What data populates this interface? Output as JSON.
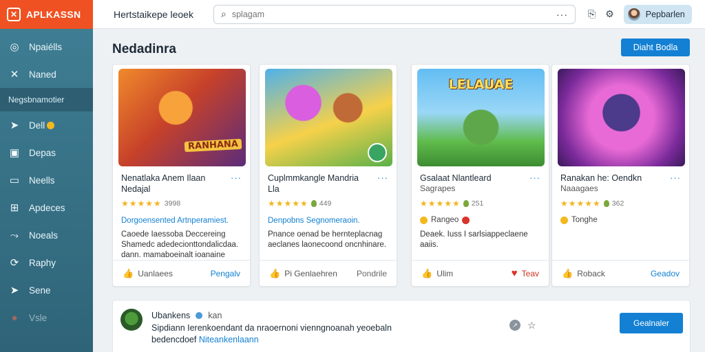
{
  "app": {
    "brand": "APLKASSN",
    "logo_icon": "x-logo-icon"
  },
  "sidebar": {
    "items": [
      {
        "label": "Npaiélls",
        "icon": "compass-icon",
        "glyph": "◎"
      },
      {
        "label": "Naned",
        "icon": "close-icon",
        "glyph": "✕"
      },
      {
        "label": "Negsbnamotier",
        "section": true
      },
      {
        "label": "Dell",
        "icon": "send-icon",
        "glyph": "➤",
        "coin": true
      },
      {
        "label": "Depas",
        "icon": "image-icon",
        "glyph": "▣"
      },
      {
        "label": "Neells",
        "icon": "window-icon",
        "glyph": "▭"
      },
      {
        "label": "Apdeces",
        "icon": "grid-icon",
        "glyph": "⊞"
      },
      {
        "label": "Noeals",
        "icon": "link-icon",
        "glyph": "⤳"
      },
      {
        "label": "Raphy",
        "icon": "refresh-icon",
        "glyph": "⟳"
      },
      {
        "label": "Sene",
        "icon": "send-icon",
        "glyph": "➤"
      },
      {
        "label": "Vsle",
        "icon": "record-icon",
        "glyph": "●",
        "faded": true
      }
    ]
  },
  "topbar": {
    "title": "Hertstaikepe leoek",
    "search_placeholder": "splagam",
    "search_more": "···",
    "icons": [
      "bookmark-icon",
      "gear-icon"
    ],
    "profile_name": "Pepbarlen"
  },
  "main": {
    "title": "Nedadinra",
    "primary_button": "Diaht Bodla"
  },
  "cards": [
    {
      "title": "Nenatlaka Anem Ilaan Nedajal",
      "more": "···",
      "rating": "★★★★★",
      "count": "3998",
      "tagline": "Dorgoensented Artnperamiest.",
      "desc": "Caoede Iaessoba Deccereing Shamedc adedecionttondalicdaa. dann. mamaboeinalt ioanaine",
      "footer_left": "Uanlaees",
      "footer_right": "Pengalv",
      "banner": "RANHANA"
    },
    {
      "title": "Cuplmmkangle Mandria Lla",
      "more": "···",
      "rating": "★★★★★",
      "count": "449",
      "tagline": "Denpobns Segnomeraoin.",
      "desc": "Pnance oenad be hernteplacnag aeclanes laonecoond oncnhinare.",
      "footer_left": "Pi Genlaehren",
      "footer_right": "Pondrile"
    },
    {
      "title": "Gsalaat Nlantleard",
      "sub": "Sagrapes",
      "more": "···",
      "rating": "★★★★★",
      "count": "251",
      "meta": "Rangeo",
      "desc": "Deaek. Iuss I sarlsiappeclaene aaiis.",
      "footer_left": "Ulim",
      "footer_right": "Teav",
      "banner": "LELAUAE"
    },
    {
      "title": "Ranakan he: Oendkn",
      "sub": "Naaagaes",
      "more": "···",
      "rating": "★★★★★",
      "count": "362",
      "meta": "Tonghe",
      "footer_left": "Roback",
      "footer_right": "Geadov"
    }
  ],
  "post": {
    "author": "Ubankens",
    "when": "kan",
    "text_line1": "Sipdiann Ierenkoendant da nraoernoni vienngnoanah yeoebaln",
    "text_line2_prefix": "bedencdoef",
    "text_link": "Niteankenlaann",
    "button": "Gealnaler"
  }
}
